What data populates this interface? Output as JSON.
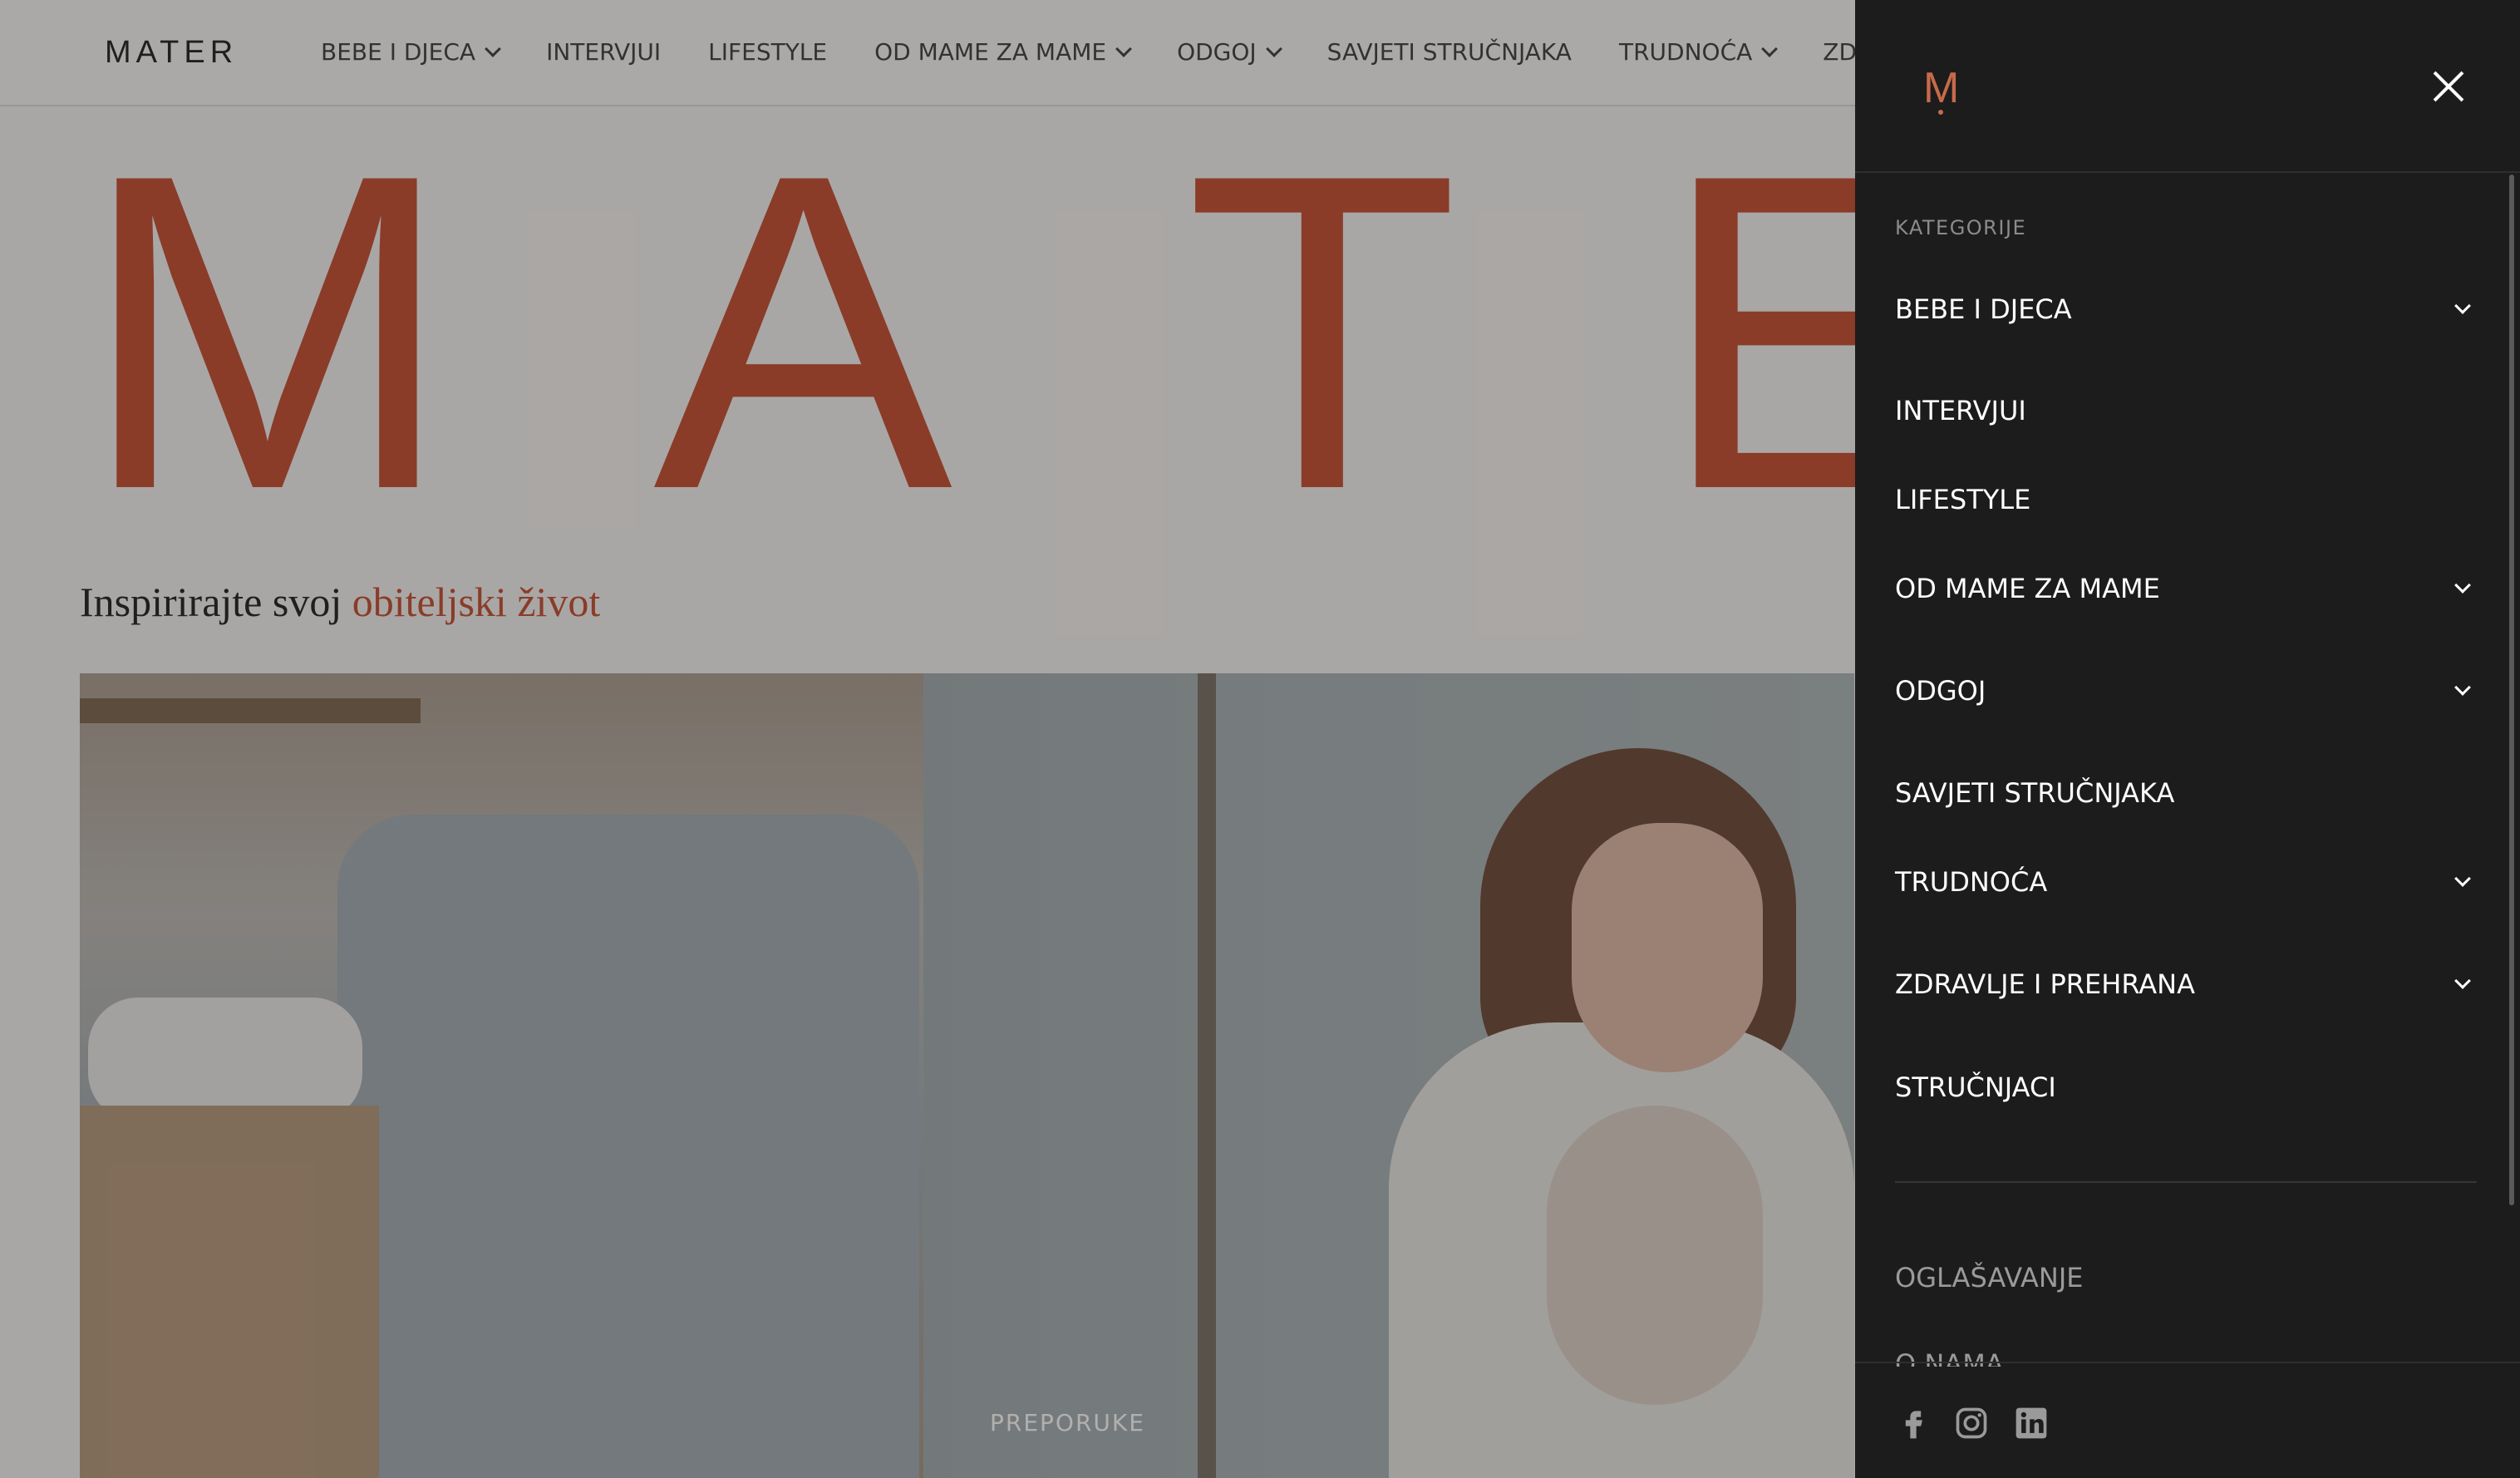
{
  "header": {
    "logo": "MATER",
    "nav": [
      {
        "label": "BEBE I DJECA",
        "dropdown": true
      },
      {
        "label": "INTERVJUI",
        "dropdown": false
      },
      {
        "label": "LIFESTYLE",
        "dropdown": false
      },
      {
        "label": "OD MAME ZA MAME",
        "dropdown": true
      },
      {
        "label": "ODGOJ",
        "dropdown": true
      },
      {
        "label": "SAVJETI STRUČNJAKA",
        "dropdown": false
      },
      {
        "label": "TRUDNOĆA",
        "dropdown": true
      },
      {
        "label": "ZDRAV",
        "dropdown": false
      }
    ]
  },
  "hero": {
    "letters": [
      "M",
      "A",
      "T",
      "E"
    ],
    "tagline_lead": "Inspirirajte svoj ",
    "tagline_accent": "obiteljski život"
  },
  "featured": {
    "label": "PREPORUKE"
  },
  "drawer": {
    "logo": "M",
    "section_label": "KATEGORIJE",
    "items": [
      {
        "label": "BEBE I DJECA",
        "expandable": true
      },
      {
        "label": "INTERVJUI",
        "expandable": false
      },
      {
        "label": "LIFESTYLE",
        "expandable": false
      },
      {
        "label": "OD MAME ZA MAME",
        "expandable": true
      },
      {
        "label": "ODGOJ",
        "expandable": true
      },
      {
        "label": "SAVJETI STRUČNJAKA",
        "expandable": false
      },
      {
        "label": "TRUDNOĆA",
        "expandable": true
      },
      {
        "label": "ZDRAVLJE I PREHRANA",
        "expandable": true
      },
      {
        "label": "STRUČNJACI",
        "expandable": false
      }
    ],
    "secondary": [
      "OGLAŠAVANJE",
      "O NAMA"
    ],
    "social": [
      "facebook-icon",
      "instagram-icon",
      "linkedin-icon"
    ]
  },
  "colors": {
    "brand_accent": "#c24a2e",
    "drawer_bg": "#1c1c1c",
    "logo_accent": "#c76a4a"
  }
}
